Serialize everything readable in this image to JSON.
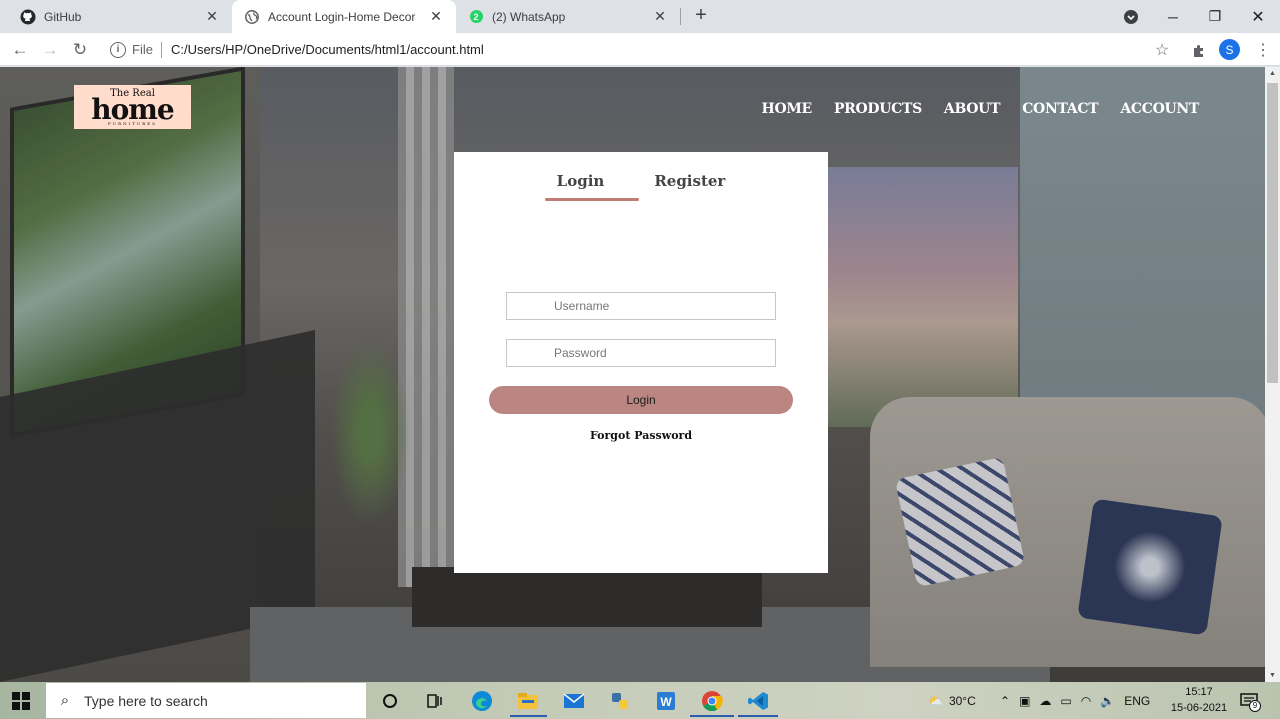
{
  "browser": {
    "tabs": [
      {
        "title": "GitHub",
        "active": false,
        "icon": "github-icon"
      },
      {
        "title": "Account Login-Home Decor",
        "active": true,
        "icon": "globe-icon"
      },
      {
        "title": "(2) WhatsApp",
        "active": false,
        "icon": "whatsapp-icon",
        "badge": "2"
      }
    ],
    "address": {
      "scheme_label": "File",
      "url": "C:/Users/HP/OneDrive/Documents/html1/account.html"
    },
    "profile_initial": "S"
  },
  "site": {
    "logo": {
      "line1": "The Real",
      "line2": "home",
      "line3": "FURNITURES"
    },
    "nav": [
      "HOME",
      "PRODUCTS",
      "ABOUT",
      "CONTACT",
      "ACCOUNT"
    ],
    "form": {
      "tab_login": "Login",
      "tab_register": "Register",
      "username_placeholder": "Username",
      "password_placeholder": "Password",
      "login_button": "Login",
      "forgot_password": "Forgot Password"
    }
  },
  "taskbar": {
    "search_placeholder": "Type here to search",
    "weather": "30°C",
    "language": "ENG",
    "time": "15:17",
    "date": "15-06-2021",
    "notification_count": "9"
  },
  "colors": {
    "accent": "#bb8582",
    "logo_bg": "#ffdccc",
    "chrome_blue": "#1a73e8"
  }
}
